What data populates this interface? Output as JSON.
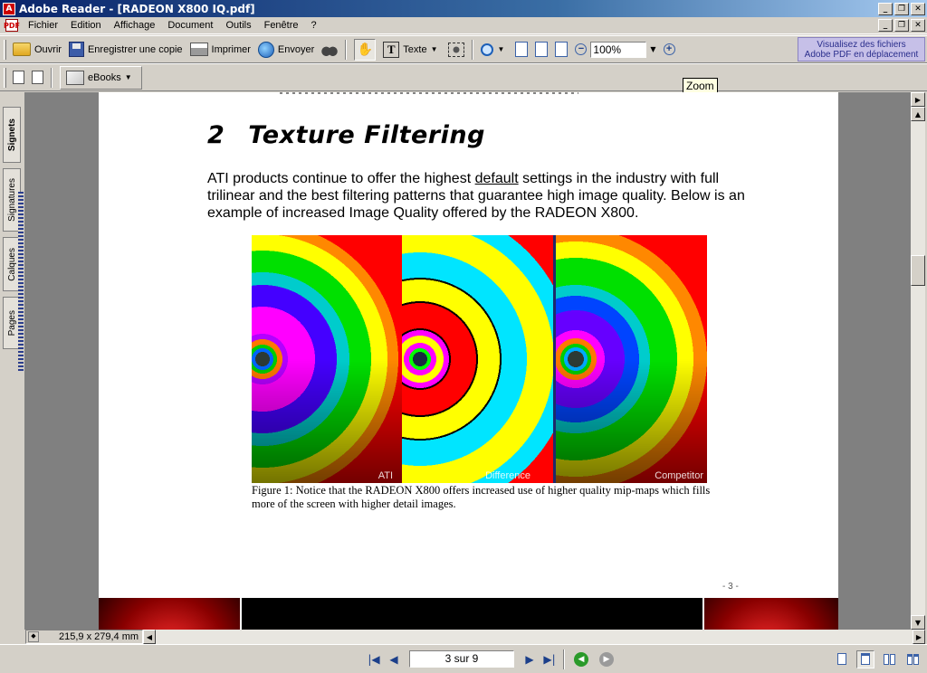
{
  "window": {
    "title": "Adobe Reader - [RADEON X800 IQ.pdf]",
    "controls": {
      "minimize": "_",
      "restore": "❐",
      "close": "✕"
    }
  },
  "menu": {
    "items": [
      "Fichier",
      "Edition",
      "Affichage",
      "Document",
      "Outils",
      "Fenêtre",
      "?"
    ]
  },
  "toolbar": {
    "open_label": "Ouvrir",
    "save_copy_label": "Enregistrer une copie",
    "print_label": "Imprimer",
    "send_label": "Envoyer",
    "text_label": "Texte",
    "zoom_value": "100%",
    "ebooks_label": "eBooks",
    "promo_line1": "Visualisez des fichiers",
    "promo_line2": "Adobe PDF en déplacement"
  },
  "tooltip": {
    "text": "Zoom"
  },
  "nav_tabs": [
    "Signets",
    "Signatures",
    "Calques",
    "Pages"
  ],
  "document": {
    "section_number": "2",
    "section_title": "Texture Filtering",
    "para_before": "ATI products continue to offer the highest ",
    "para_underlined": "default",
    "para_after": " settings in the industry with full trilinear and the best filtering patterns that guarantee high image quality. Below is an example of increased Image Quality offered by the RADEON X800.",
    "figure_labels": {
      "left": "ATI",
      "middle": "Difference",
      "right": "Competitor"
    },
    "caption": "Figure 1: Notice that the RADEON X800 offers increased use of higher quality mip-maps which fills more of the screen with higher detail images.",
    "page_number": "- 3 -"
  },
  "status": {
    "page_size": "215,9 x 279,4 mm",
    "page_indicator": "3 sur 9"
  },
  "colors": {
    "titlebar": "#0a246a",
    "chrome": "#d4d0c8",
    "doc_background": "#808080",
    "promo_bg": "#c6c0e8"
  }
}
